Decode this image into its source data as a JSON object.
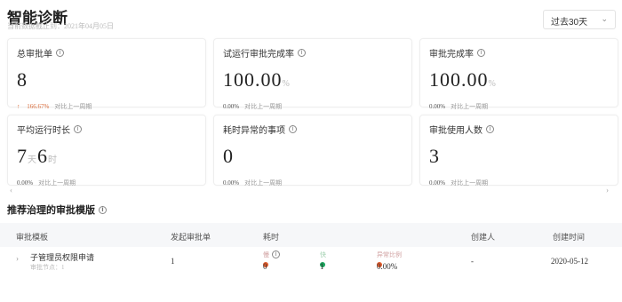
{
  "header": {
    "title": "智能诊断",
    "subtitle": "当前数据截止到：2021年04月05日"
  },
  "range_select": {
    "value": "过去30天"
  },
  "cards": [
    {
      "label": "总审批单",
      "value": "8",
      "unit": "",
      "rate": "166.67%",
      "compare": "对比上一周期",
      "trend": "up"
    },
    {
      "label": "试运行审批完成率",
      "value": "100.00",
      "unit": "%",
      "rate": "0.00%",
      "compare": "对比上一周期",
      "trend": "flat"
    },
    {
      "label": "审批完成率",
      "value": "100.00",
      "unit": "%",
      "rate": "0.00%",
      "compare": "对比上一周期",
      "trend": "flat"
    },
    {
      "label": "平均运行时长",
      "value": "7",
      "unit": "天",
      "value2": "6",
      "unit2": "时",
      "rate": "0.00%",
      "compare": "对比上一周期",
      "trend": "flat"
    },
    {
      "label": "耗时异常的事项",
      "value": "0",
      "unit": "",
      "rate": "0.00%",
      "compare": "对比上一周期",
      "trend": "flat"
    },
    {
      "label": "审批使用人数",
      "value": "3",
      "unit": "",
      "rate": "0.00%",
      "compare": "对比上一周期",
      "trend": "flat"
    }
  ],
  "section": {
    "title": "推荐治理的审批模版"
  },
  "table": {
    "columns": [
      "审批模板",
      "发起审批单",
      "耗时",
      "创建人",
      "创建时间"
    ],
    "rows": [
      {
        "name": "子管理员权限申请",
        "sub": "审批节点：1",
        "count": "1",
        "slow_label": "慢",
        "slow_value": "0",
        "fast_label": "快",
        "fast_value": "1",
        "ratio_label": "异常比例",
        "ratio_value": "0.00%",
        "creator": "-",
        "created": "2020-05-12"
      }
    ]
  },
  "colors": {
    "up": "#d96b3a",
    "slow": "#e05a2b",
    "fast": "#1aa35c"
  }
}
